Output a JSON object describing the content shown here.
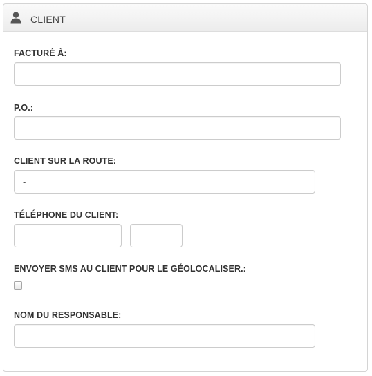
{
  "panel": {
    "title": "CLIENT",
    "icon": "user-icon"
  },
  "form": {
    "facture_label": "FACTURÉ À:",
    "facture_value": "",
    "po_label": "P.O.:",
    "po_value": "",
    "client_route_label": "CLIENT SUR LA ROUTE:",
    "client_route_value": "-",
    "telephone_label": "TÉLÉPHONE DU CLIENT:",
    "telephone_value": "",
    "telephone_ext_value": "",
    "sms_label": "ENVOYER SMS AU CLIENT POUR LE GÉOLOCALISER.:",
    "sms_checked": false,
    "responsable_label": "NOM DU RESPONSABLE:",
    "responsable_value": ""
  }
}
